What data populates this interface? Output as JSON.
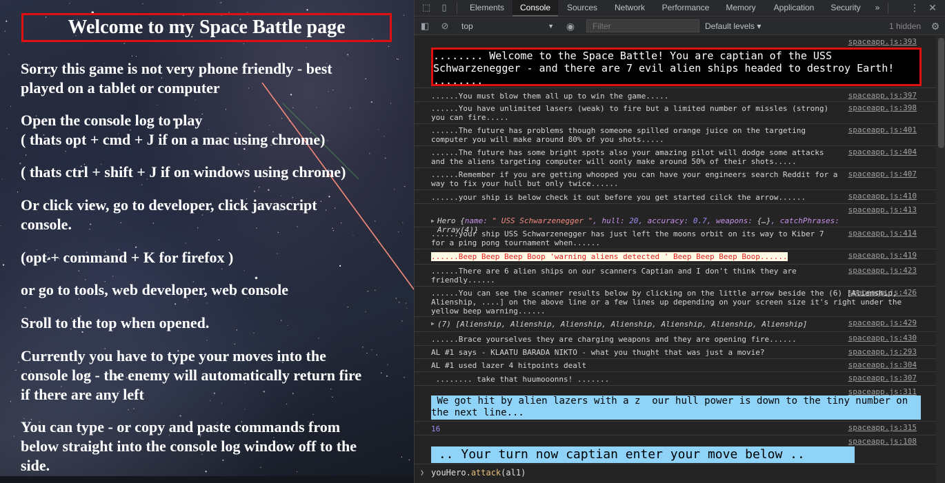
{
  "page": {
    "title": "Welcome to my Space Battle page",
    "paragraphs": [
      "Sorry this game is not very phone friendly - best\nplayed on a tablet or computer",
      "Open the console log to play\n( thats opt + cmd + J if on a mac using chrome)",
      "( thats ctrl + shift + J if on windows using chrome)",
      "Or click view, go to developer, click javascript\nconsole.",
      "(opt + command + K for firefox )",
      "or go to tools, web developer, web console",
      "Sroll to the top when opened.",
      "Currently you have to type your moves into the\nconsole log - the enemy will automatically return fire\nif there are any left",
      "You can type - or copy and paste commands from\nbelow straight into the console log window off to the\nside."
    ]
  },
  "devtools": {
    "tabs": [
      "Elements",
      "Console",
      "Sources",
      "Network",
      "Performance",
      "Memory",
      "Application",
      "Security"
    ],
    "more_tabs": "»",
    "active_tab": "Console",
    "context": "top",
    "filter_placeholder": "Filter",
    "levels": "Default levels ▾",
    "hidden_count": "1 hidden",
    "prompt_object": "youHero",
    "prompt_method": "attack",
    "prompt_args": "(al1)"
  },
  "console": {
    "banner": {
      "src": "spaceapp.js:393",
      "text": "........ Welcome to the Space Battle! You are captian of the USS Schwarzenegger - and there are 7 evil alien ships headed to destroy Earth! ........"
    },
    "messages": [
      {
        "src": "spaceapp.js:397",
        "text": "......You must blow them all up to win the game....."
      },
      {
        "src": "spaceapp.js:398",
        "text": "......You have unlimited lasers (weak) to fire but a limited number of missles (strong) you can fire....."
      },
      {
        "src": "spaceapp.js:401",
        "text": "......The future has problems though someone spilled orange juice on the targeting computer you will make around 80% of you shots....."
      },
      {
        "src": "spaceapp.js:404",
        "text": "......The future has some bright spots also your amazing pilot will dodge some attacks and the aliens targeting computer will oonly make around 50% of their shots....."
      },
      {
        "src": "spaceapp.js:407",
        "text": "......Remember if you are getting whooped you can have your engineers search Reddit for a way to fix your hull but only twice......"
      },
      {
        "src": "spaceapp.js:410",
        "text": "......your ship is below check it out before you get started cilck the arrow......"
      }
    ],
    "hero": {
      "src": "spaceapp.js:413",
      "prefix": "Hero {",
      "name_key": "name: ",
      "name_val": "\" USS Schwarzenegger \"",
      "hull_key": ", hull: ",
      "hull_val": "20",
      "acc_key": ", accuracy: ",
      "acc_val": "0.7",
      "weapons_key": ", weapons: ",
      "weapons_val": "{…}",
      "phrases_key": ", catchPhrases: ",
      "phrases_val": "Array(4)}"
    },
    "messages2": [
      {
        "src": "spaceapp.js:414",
        "text": "......your ship USS Schwarzenegger has just left the moons orbit on its way to Kiber 7 for a ping pong tournament when......"
      },
      {
        "src": "spaceapp.js:419",
        "text": "......Beep Beep Beep Boop 'warning aliens detected ' Beep Beep Beep Boop......"
      },
      {
        "src": "spaceapp.js:423",
        "text": "......There are 6 alien ships on our scanners Captian and I don't think they are friendly......"
      },
      {
        "src": "spaceapp.js:426",
        "text": "......You can see the scanner results below by clicking on the little arrow beside the (6) [Alienship, Alienship, ....] on the above line or a few lines up depending on your screen size it's right under the yellow beep warning......"
      },
      {
        "src": "spaceapp.js:429",
        "text": "(7) [Alienship, Alienship, Alienship, Alienship, Alienship, Alienship, Alienship]"
      },
      {
        "src": "spaceapp.js:430",
        "text": "......Brace yourselves they are charging weapons and they are opening fire......"
      },
      {
        "src": "spaceapp.js:293",
        "text": "AL #1 says - KLAATU BARADA NIKTO - what you thught that was just a movie?"
      },
      {
        "src": "spaceapp.js:304",
        "text": "AL #1 used lazer 4 hitpoints dealt"
      },
      {
        "src": "spaceapp.js:307",
        "text": " ........ take that huumooonns! ......."
      }
    ],
    "hit": {
      "src": "spaceapp.js:311",
      "text": " We got hit by alien lazers with a z  our hull power is down to the tiny number on the next line..."
    },
    "number": {
      "src": "spaceapp.js:315",
      "text": "16"
    },
    "turn": {
      "src": "spaceapp.js:108",
      "text": " .. Your turn now captian enter your move below .. "
    }
  }
}
